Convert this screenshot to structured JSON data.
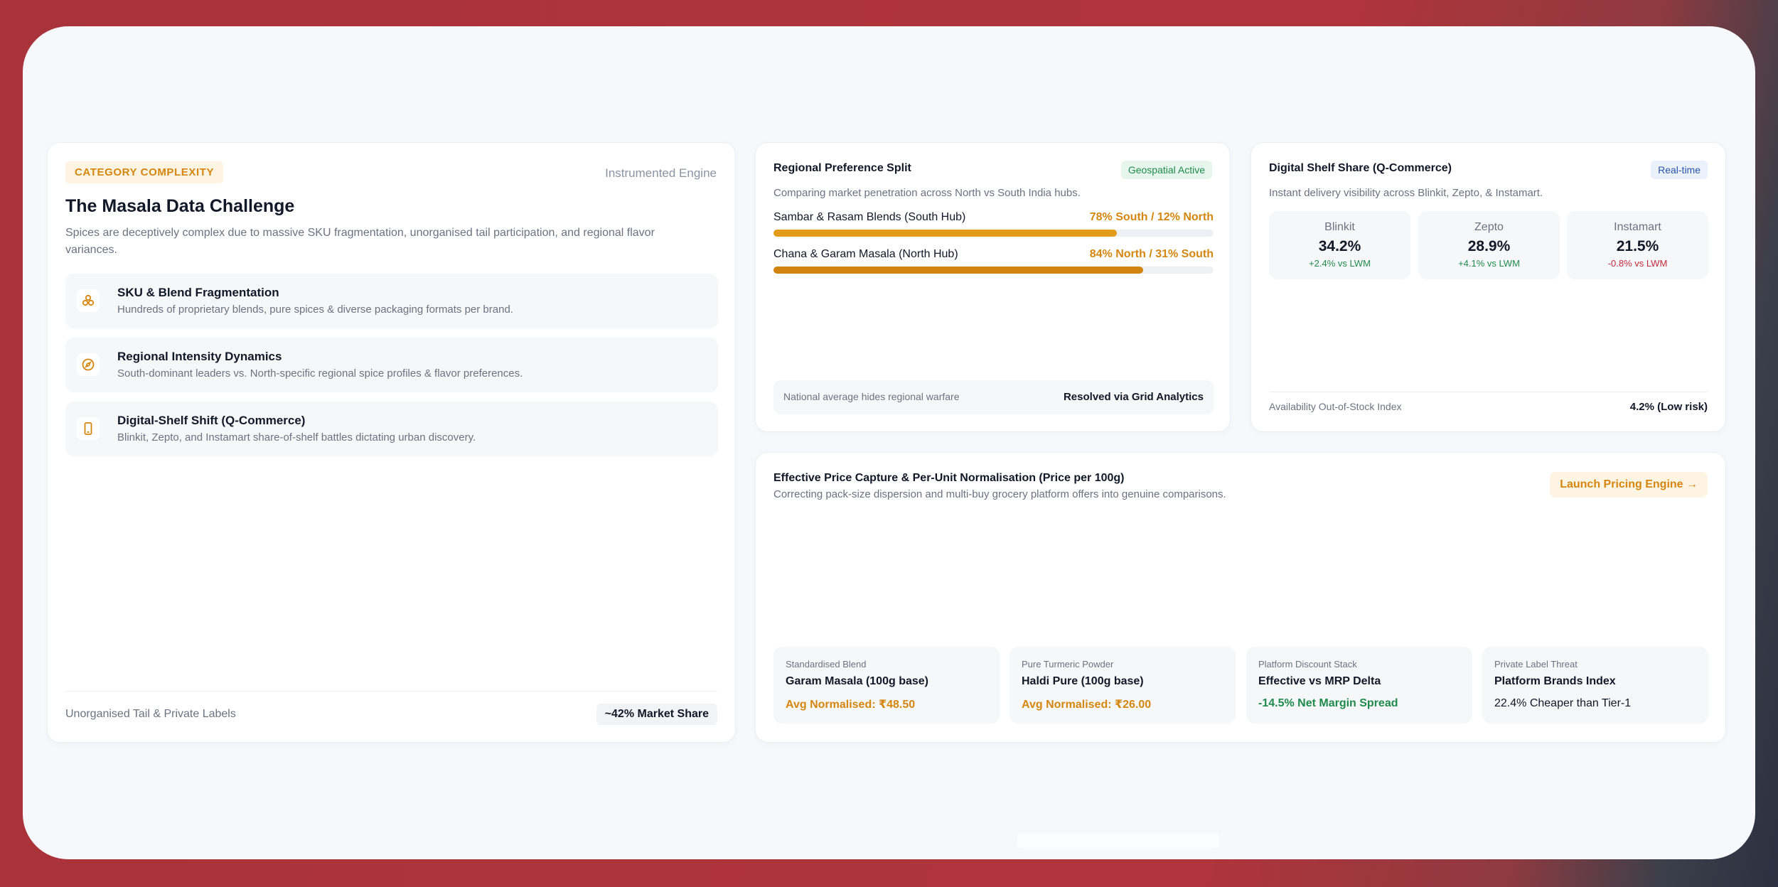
{
  "category_card": {
    "badge": "CATEGORY COMPLEXITY",
    "engine_label": "Instrumented Engine",
    "title": "The Masala Data Challenge",
    "subtitle": "Spices are deceptively complex due to massive SKU fragmentation, unorganised tail participation, and regional flavor variances.",
    "features": [
      {
        "icon": "blend-icon",
        "title": "SKU & Blend Fragmentation",
        "description": "Hundreds of proprietary blends, pure spices & diverse packaging formats per brand."
      },
      {
        "icon": "compass-icon",
        "title": "Regional Intensity Dynamics",
        "description": "South-dominant leaders vs. North-specific regional spice profiles & flavor preferences."
      },
      {
        "icon": "mobile-icon",
        "title": "Digital-Shelf Shift (Q-Commerce)",
        "description": "Blinkit, Zepto, and Instamart share-of-shelf battles dictating urban discovery."
      }
    ],
    "footer_label": "Unorganised Tail & Private Labels",
    "footer_value": "~42% Market Share"
  },
  "regional_card": {
    "title": "Regional Preference Split",
    "badge": "Geospatial Active",
    "subtitle": "Comparing market penetration across North vs South India hubs.",
    "rows": [
      {
        "label": "Sambar & Rasam Blends (South Hub)",
        "value": "78% South / 12% North",
        "fill_fraction": 0.78
      },
      {
        "label": "Chana & Garam Masala (North Hub)",
        "value": "84% North / 31% South",
        "fill_fraction": 0.84
      }
    ],
    "footer_left": "National average hides regional warfare",
    "footer_right": "Resolved via Grid Analytics"
  },
  "shelf_card": {
    "title": "Digital Shelf Share (Q-Commerce)",
    "badge": "Real-time",
    "subtitle": "Instant delivery visibility across Blinkit, Zepto, & Instamart.",
    "platforms": [
      {
        "name": "Blinkit",
        "share": "34.2%",
        "delta": "+2.4% vs LWM",
        "trend": "up"
      },
      {
        "name": "Zepto",
        "share": "28.9%",
        "delta": "+4.1% vs LWM",
        "trend": "up"
      },
      {
        "name": "Instamart",
        "share": "21.5%",
        "delta": "-0.8% vs LWM",
        "trend": "down"
      }
    ],
    "footer_left": "Availability Out-of-Stock Index",
    "footer_right": "4.2% (Low risk)"
  },
  "pricing_card": {
    "title": "Effective Price Capture & Per-Unit Normalisation (Price per 100g)",
    "subtitle": "Correcting pack-size dispersion and multi-buy grocery platform offers into genuine comparisons.",
    "button_label": "Launch Pricing Engine →",
    "tiles": [
      {
        "type": "Standardised Blend",
        "name": "Garam Masala (100g base)",
        "value": "Avg Normalised: ₹48.50",
        "tone": "amber"
      },
      {
        "type": "Pure Turmeric Powder",
        "name": "Haldi Pure (100g base)",
        "value": "Avg Normalised: ₹26.00",
        "tone": "amber"
      },
      {
        "type": "Platform Discount Stack",
        "name": "Effective vs MRP Delta",
        "value": "-14.5% Net Margin Spread",
        "tone": "green"
      },
      {
        "type": "Private Label Threat",
        "name": "Platform Brands Index",
        "value": "22.4% Cheaper than Tier-1",
        "tone": "dark"
      }
    ]
  },
  "colors": {
    "accent_amber": "#d4860f",
    "positive_green": "#1f8a4c",
    "negative_red": "#c02a3b",
    "frame_red": "#a9333a"
  }
}
